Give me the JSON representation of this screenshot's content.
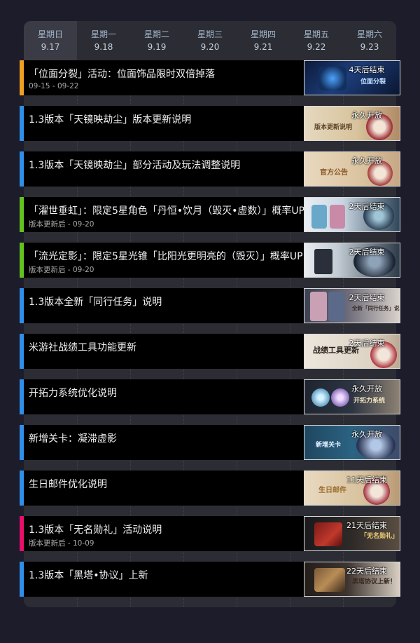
{
  "days": [
    {
      "name": "星期日",
      "date": "9.17"
    },
    {
      "name": "星期一",
      "date": "9.18"
    },
    {
      "name": "星期二",
      "date": "9.19"
    },
    {
      "name": "星期三",
      "date": "9.20"
    },
    {
      "name": "星期四",
      "date": "9.21"
    },
    {
      "name": "星期五",
      "date": "9.22"
    },
    {
      "name": "星期六",
      "date": "9.23"
    }
  ],
  "events": [
    {
      "title": "「位面分裂」活动：位面饰品限时双倍掉落",
      "dates": "09-15 - 09-22",
      "status": "4天后结束",
      "accent": "#f0a020",
      "banner": "位面分裂"
    },
    {
      "title": "1.3版本「天镜映劫尘」版本更新说明",
      "dates": "",
      "status": "永久开放",
      "accent": "#2f8fe8",
      "banner": "版本更新说明"
    },
    {
      "title": "1.3版本「天镜映劫尘」部分活动及玩法调整说明",
      "dates": "",
      "status": "永久开放",
      "accent": "#2f8fe8",
      "banner": "官方公告"
    },
    {
      "title": "「濯世垂虹」：限定5星角色「丹恒•饮月（毁灭•虚数）」概率UP",
      "dates": "版本更新后 - 09-20",
      "status": "2天后结束",
      "accent": "#62c21e",
      "banner": ""
    },
    {
      "title": "「流光定影」：限定5星光锥「比阳光更明亮的（毁灭）」概率UP",
      "dates": "版本更新后 - 09-20",
      "status": "2天后结束",
      "accent": "#62c21e",
      "banner": ""
    },
    {
      "title": "1.3版本全新「同行任务」说明",
      "dates": "",
      "status": "2天后结束",
      "accent": "#2f8fe8",
      "banner": "全新「同行任务」说明"
    },
    {
      "title": "米游社战绩工具功能更新",
      "dates": "",
      "status": "2天后结束",
      "accent": "#2f8fe8",
      "banner": "战绩工具更新"
    },
    {
      "title": "开拓力系统优化说明",
      "dates": "",
      "status": "永久开放",
      "accent": "#2f8fe8",
      "banner": "开拓力系统"
    },
    {
      "title": "新增关卡：凝滞虚影",
      "dates": "",
      "status": "永久开放",
      "accent": "#2f8fe8",
      "banner": "新增关卡"
    },
    {
      "title": "生日邮件优化说明",
      "dates": "",
      "status": "11天后结束",
      "accent": "#2f8fe8",
      "banner": "生日邮件"
    },
    {
      "title": "1.3版本「无名勋礼」活动说明",
      "dates": "版本更新后 - 10-09",
      "status": "21天后结束",
      "accent": "#e8106a",
      "banner": "「无名勋礼」"
    },
    {
      "title": "1.3版本「黑塔•协议」上新",
      "dates": "",
      "status": "22天后结束",
      "accent": "#2f8fe8",
      "banner": "黑塔协议上新！"
    }
  ]
}
